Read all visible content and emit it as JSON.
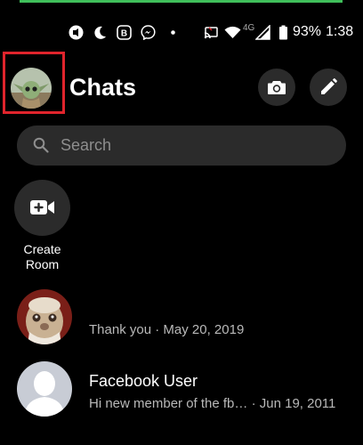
{
  "status_bar": {
    "network": "4G",
    "battery": "93%",
    "time": "1:38"
  },
  "header": {
    "title": "Chats"
  },
  "search": {
    "placeholder": "Search"
  },
  "create_room": {
    "label": "Create Room"
  },
  "chats": [
    {
      "name": "",
      "last_message": "Thank you",
      "separator": " · ",
      "date": "May 20, 2019"
    },
    {
      "name": "Facebook User",
      "last_message": "Hi new member of the fb…",
      "separator": " · ",
      "date": "Jun 19, 2011"
    }
  ],
  "icons": {
    "status_bar": [
      "radio-icon",
      "moon-icon",
      "app-b-icon",
      "messenger-icon",
      "dot-icon",
      "cast-icon",
      "wifi-icon",
      "signal-icon",
      "battery-icon"
    ],
    "header": [
      "camera-icon",
      "pencil-icon"
    ],
    "search": "search-icon",
    "create_room": "video-add-icon"
  },
  "colors": {
    "highlight_box": "#e0242c",
    "top_line": "#3fbf5a",
    "button_bg": "#2b2b2b"
  }
}
